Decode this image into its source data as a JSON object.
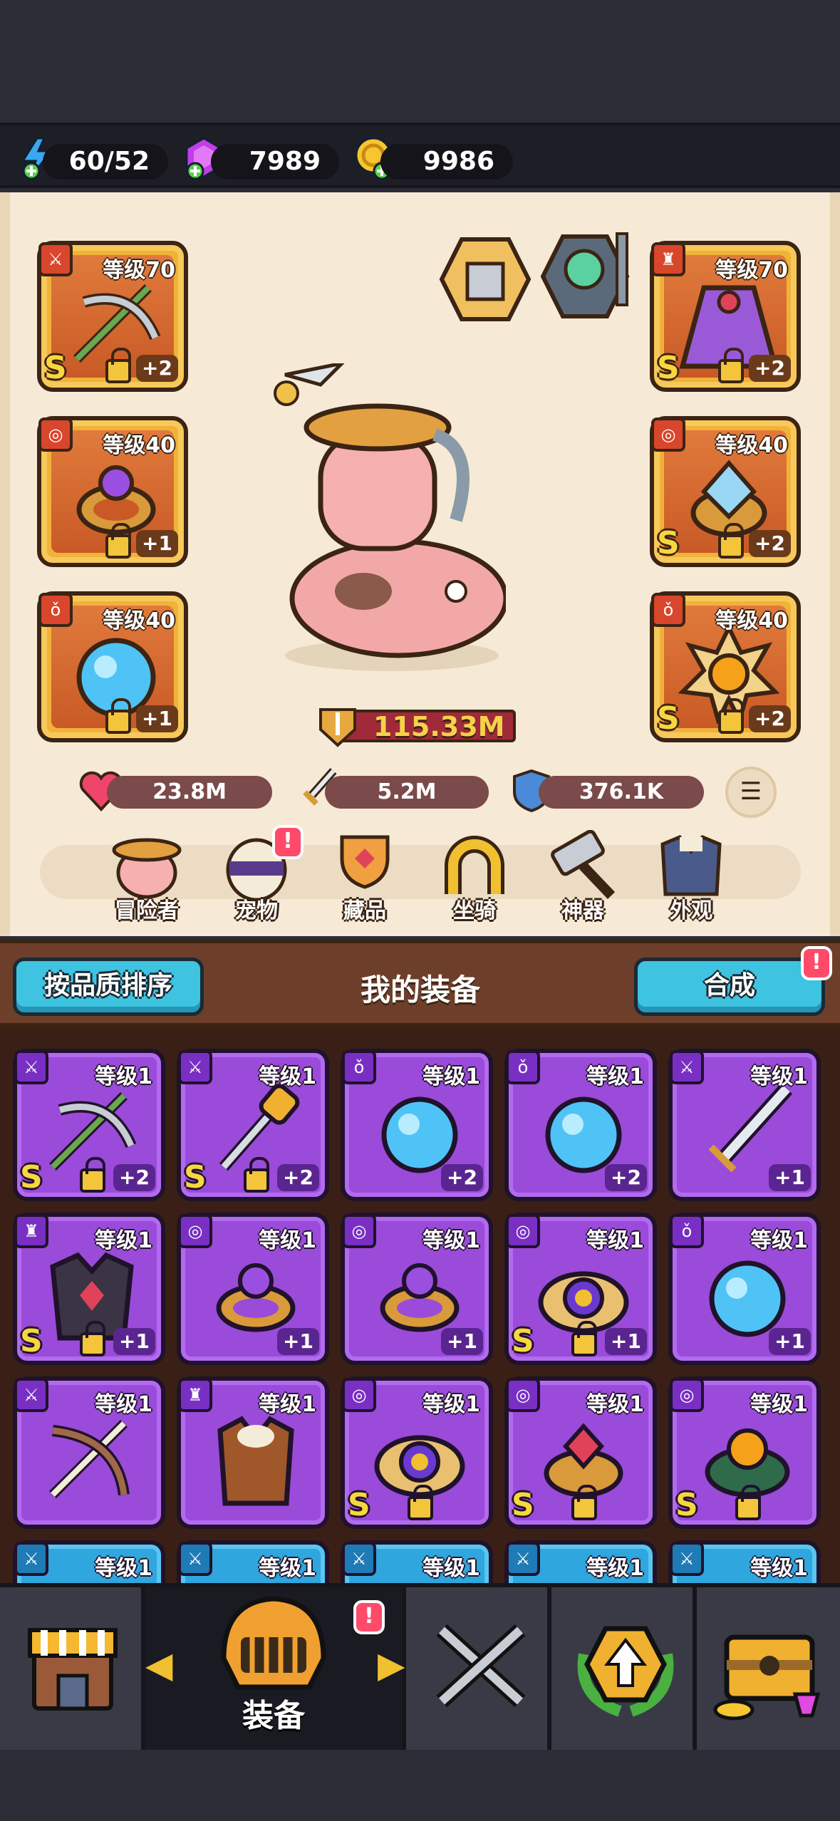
{
  "resources": {
    "energy": {
      "value": "60/52",
      "icon": "lightning-plus-icon"
    },
    "gems": {
      "value": "7989",
      "icon": "purple-gem-plus-icon"
    },
    "coins": {
      "value": "9986",
      "icon": "gold-coin-plus-icon"
    }
  },
  "equipped": {
    "left": [
      {
        "level": "等级70",
        "rarity": "S",
        "plus": "+2",
        "item": "crossbow",
        "category": "weapon"
      },
      {
        "level": "等级40",
        "rarity": "",
        "plus": "+1",
        "item": "ring",
        "category": "ring"
      },
      {
        "level": "等级40",
        "rarity": "",
        "plus": "+1",
        "item": "orb",
        "category": "amulet"
      }
    ],
    "right": [
      {
        "level": "等级70",
        "rarity": "S",
        "plus": "+2",
        "item": "cape",
        "category": "armor"
      },
      {
        "level": "等级40",
        "rarity": "S",
        "plus": "+2",
        "item": "crystal-ring",
        "category": "ring"
      },
      {
        "level": "等级40",
        "rarity": "S",
        "plus": "+2",
        "item": "sun-amulet",
        "category": "amulet"
      }
    ]
  },
  "power": "115.33M",
  "stats": {
    "hp": "23.8M",
    "attack": "5.2M",
    "defense": "376.1K"
  },
  "nav": [
    {
      "label": "冒险者",
      "icon": "pig-adventurer-icon",
      "badge": ""
    },
    {
      "label": "宠物",
      "icon": "egg-pet-icon",
      "badge": "!"
    },
    {
      "label": "藏品",
      "icon": "trophy-collection-icon",
      "badge": ""
    },
    {
      "label": "坐骑",
      "icon": "horseshoe-mount-icon",
      "badge": ""
    },
    {
      "label": "神器",
      "icon": "hammer-artifact-icon",
      "badge": ""
    },
    {
      "label": "外观",
      "icon": "outfit-appearance-icon",
      "badge": ""
    }
  ],
  "equipment_header": {
    "sort_button": "按品质排序",
    "title": "我的装备",
    "merge_button": "合成",
    "merge_badge": "!"
  },
  "inventory": [
    {
      "level": "等级1",
      "rarity": "S",
      "plus": "+2",
      "locked": true,
      "item": "crossbow",
      "category": "weapon"
    },
    {
      "level": "等级1",
      "rarity": "S",
      "plus": "+2",
      "locked": true,
      "item": "club",
      "category": "weapon"
    },
    {
      "level": "等级1",
      "rarity": "",
      "plus": "+2",
      "locked": false,
      "item": "orb",
      "category": "amulet"
    },
    {
      "level": "等级1",
      "rarity": "",
      "plus": "+2",
      "locked": false,
      "item": "orb",
      "category": "amulet"
    },
    {
      "level": "等级1",
      "rarity": "",
      "plus": "+1",
      "locked": false,
      "item": "sword",
      "category": "weapon"
    },
    {
      "level": "等级1",
      "rarity": "S",
      "plus": "+1",
      "locked": true,
      "item": "dark-armor",
      "category": "armor"
    },
    {
      "level": "等级1",
      "rarity": "",
      "plus": "+1",
      "locked": false,
      "item": "ring",
      "category": "ring"
    },
    {
      "level": "等级1",
      "rarity": "",
      "plus": "+1",
      "locked": false,
      "item": "ring",
      "category": "ring"
    },
    {
      "level": "等级1",
      "rarity": "S",
      "plus": "+1",
      "locked": true,
      "item": "ornate-ring",
      "category": "ring"
    },
    {
      "level": "等级1",
      "rarity": "",
      "plus": "+1",
      "locked": false,
      "item": "orb",
      "category": "amulet"
    },
    {
      "level": "等级1",
      "rarity": "",
      "plus": "",
      "locked": false,
      "item": "bone-crossbow",
      "category": "weapon"
    },
    {
      "level": "等级1",
      "rarity": "",
      "plus": "",
      "locked": false,
      "item": "leather-vest",
      "category": "armor"
    },
    {
      "level": "等级1",
      "rarity": "S",
      "plus": "",
      "locked": true,
      "item": "ornate-ring",
      "category": "ring"
    },
    {
      "level": "等级1",
      "rarity": "S",
      "plus": "",
      "locked": true,
      "item": "ruby-ring",
      "category": "ring"
    },
    {
      "level": "等级1",
      "rarity": "S",
      "plus": "",
      "locked": true,
      "item": "serpent-ring",
      "category": "ring"
    },
    {
      "level": "等级1",
      "rarity": "",
      "plus": "",
      "locked": false,
      "item": "blue-item",
      "category": "weapon"
    },
    {
      "level": "等级1",
      "rarity": "",
      "plus": "",
      "locked": false,
      "item": "blue-item",
      "category": "weapon"
    },
    {
      "level": "等级1",
      "rarity": "",
      "plus": "",
      "locked": false,
      "item": "blue-item",
      "category": "weapon"
    },
    {
      "level": "等级1",
      "rarity": "",
      "plus": "",
      "locked": false,
      "item": "blue-item",
      "category": "weapon"
    },
    {
      "level": "等级1",
      "rarity": "",
      "plus": "",
      "locked": false,
      "item": "blue-item",
      "category": "weapon"
    }
  ],
  "bottom_nav": [
    {
      "label": "",
      "icon": "shop-icon"
    },
    {
      "label": "装备",
      "icon": "helmet-equipment-icon",
      "badge": "!"
    },
    {
      "label": "",
      "icon": "crossed-swords-icon"
    },
    {
      "label": "",
      "icon": "upgrade-laurel-icon"
    },
    {
      "label": "",
      "icon": "treasure-chest-icon"
    }
  ],
  "colors": {
    "gold_slot": "#f1b23a",
    "epic_purple": "#9a4bd9",
    "rare_blue": "#2fa6de",
    "accent_cyan": "#3ec3e0",
    "badge_red": "#ff4a6a"
  }
}
